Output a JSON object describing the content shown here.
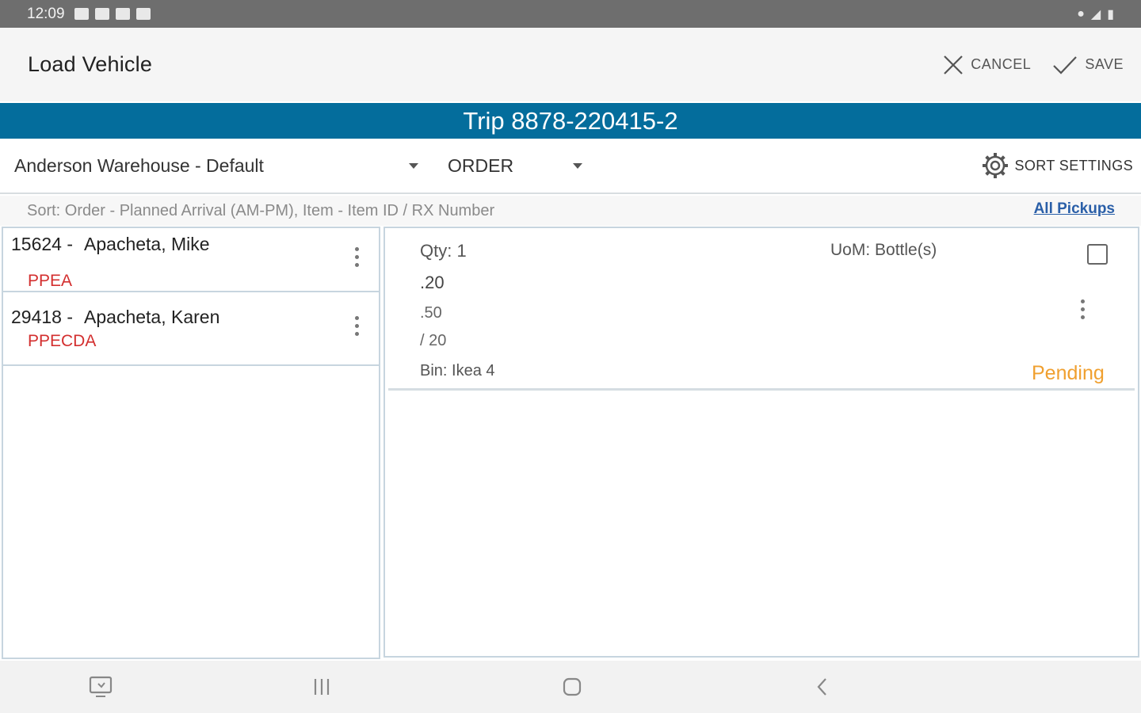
{
  "status_bar": {
    "time": "12:09"
  },
  "app_bar": {
    "title": "Load Vehicle",
    "cancel_label": "CANCEL",
    "save_label": "SAVE"
  },
  "trip": {
    "title": "Trip 8878-220415-2"
  },
  "filters": {
    "warehouse_selected": "Anderson Warehouse - Default",
    "order_selected": "ORDER",
    "sort_settings_label": "SORT SETTINGS"
  },
  "sort": {
    "text": "Sort: Order - Planned Arrival (AM-PM), Item - Item ID / RX Number",
    "all_pickups_label": "All Pickups"
  },
  "orders": [
    {
      "id": "15624 -",
      "name": "Apacheta, Mike",
      "code": "PPEA"
    },
    {
      "id": "29418 -",
      "name": "Apacheta, Karen",
      "code": "PPECDA"
    }
  ],
  "item": {
    "qty": "Qty: 1",
    "uom": "UoM: Bottle(s)",
    "line1": ".20",
    "line2": ".50",
    "line3": "/ 20",
    "bin": "Bin: Ikea 4",
    "status": "Pending"
  },
  "colors": {
    "accent": "#046d9c",
    "pending": "#f0a030",
    "code_red": "#d32f2f",
    "link": "#2a5fa8"
  },
  "icons": {
    "cancel": "close-icon",
    "save": "check-icon",
    "settings": "gear-icon",
    "more": "more-vert-icon"
  }
}
